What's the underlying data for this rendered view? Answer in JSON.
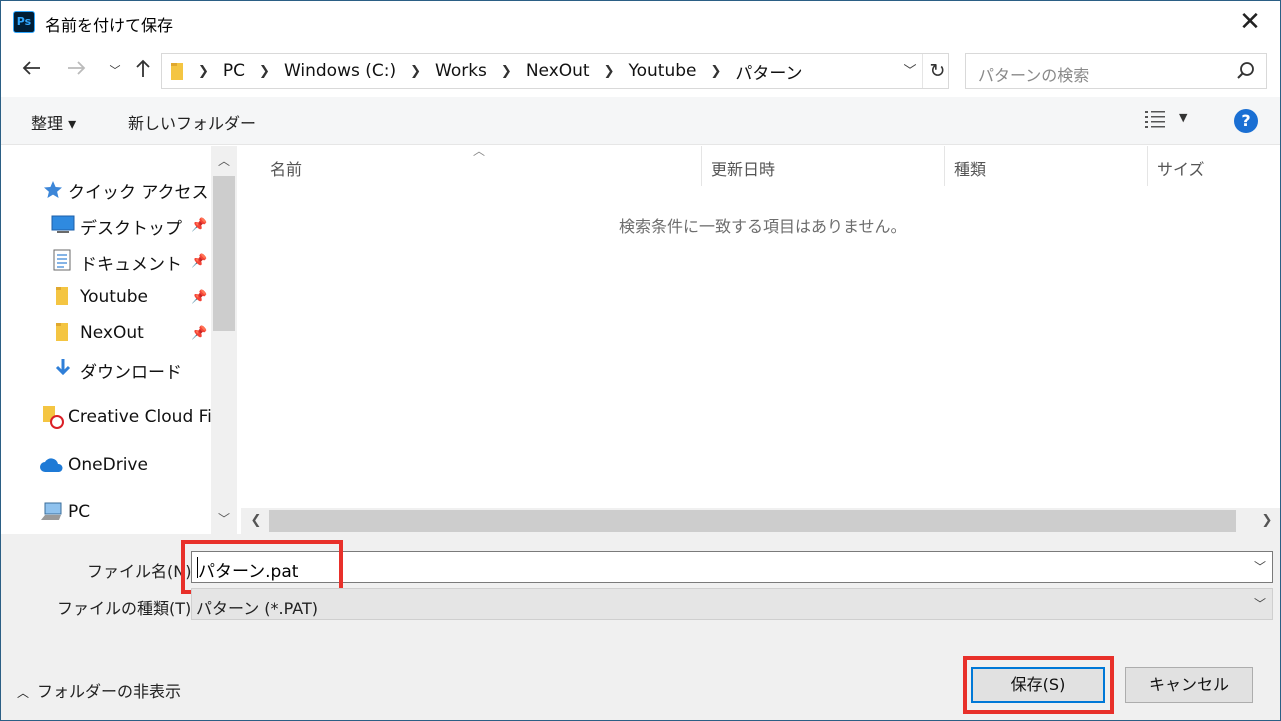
{
  "window": {
    "title": "名前を付けて保存",
    "app_icon_text": "Ps"
  },
  "nav": {
    "breadcrumbs": [
      "PC",
      "Windows (C:)",
      "Works",
      "NexOut",
      "Youtube",
      "パターン"
    ],
    "search_placeholder": "パターンの検索"
  },
  "toolbar": {
    "organize_label": "整理 ▾",
    "new_folder_label": "新しいフォルダー"
  },
  "sidebar": {
    "quick_access": "クイック アクセス",
    "items": [
      {
        "label": "デスクトップ",
        "icon": "desktop-icon"
      },
      {
        "label": "ドキュメント",
        "icon": "document-icon"
      },
      {
        "label": "Youtube",
        "icon": "folder-icon"
      },
      {
        "label": "NexOut",
        "icon": "folder-icon"
      },
      {
        "label": "ダウンロード",
        "icon": "download-icon"
      }
    ],
    "creative_cloud": "Creative Cloud Files",
    "onedrive": "OneDrive",
    "pc": "PC"
  },
  "filelist": {
    "columns": [
      "名前",
      "更新日時",
      "種類",
      "サイズ"
    ],
    "empty_message": "検索条件に一致する項目はありません。"
  },
  "form": {
    "filename_label": "ファイル名(N):",
    "filename_value": "パターン.pat",
    "filetype_label": "ファイルの種類(T):",
    "filetype_value": "パターン (*.PAT)"
  },
  "footer": {
    "hide_folders_label": "フォルダーの非表示",
    "save_label": "保存(S)",
    "cancel_label": "キャンセル"
  },
  "colors": {
    "highlight_red": "#e8302a",
    "accent_blue": "#0078d7"
  }
}
